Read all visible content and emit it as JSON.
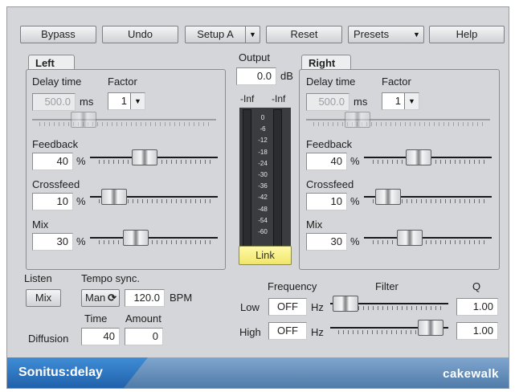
{
  "toolbar": {
    "bypass": "Bypass",
    "undo": "Undo",
    "setup": "Setup A",
    "reset": "Reset",
    "presets": "Presets",
    "help": "Help"
  },
  "output": {
    "label": "Output",
    "value": "0.0",
    "unit": "dB",
    "meter_left_peak": "-Inf",
    "meter_right_peak": "-Inf",
    "scale": [
      "0",
      "-6",
      "-12",
      "-18",
      "-24",
      "-30",
      "-36",
      "-42",
      "-48",
      "-54",
      "-60"
    ],
    "link": "Link"
  },
  "left": {
    "tab": "Left",
    "delay_label": "Delay time",
    "delay_value": "500.0",
    "delay_unit": "ms",
    "factor_label": "Factor",
    "factor_value": "1",
    "feedback_label": "Feedback",
    "feedback_value": "40",
    "crossfeed_label": "Crossfeed",
    "crossfeed_value": "10",
    "mix_label": "Mix",
    "mix_value": "30",
    "percent": "%"
  },
  "right": {
    "tab": "Right",
    "delay_label": "Delay time",
    "delay_value": "500.0",
    "delay_unit": "ms",
    "factor_label": "Factor",
    "factor_value": "1",
    "feedback_label": "Feedback",
    "feedback_value": "40",
    "crossfeed_label": "Crossfeed",
    "crossfeed_value": "10",
    "mix_label": "Mix",
    "mix_value": "30",
    "percent": "%"
  },
  "bottom": {
    "listen_label": "Listen",
    "listen_value": "Mix",
    "tempo_label": "Tempo sync.",
    "tempo_mode": "Man",
    "bpm_value": "120.0",
    "bpm_unit": "BPM",
    "diffusion_label": "Diffusion",
    "time_label": "Time",
    "time_value": "40",
    "amount_label": "Amount",
    "amount_value": "0"
  },
  "filter": {
    "frequency_label": "Frequency",
    "filter_label": "Filter",
    "q_label": "Q",
    "low_label": "Low",
    "low_value": "OFF",
    "high_label": "High",
    "high_value": "OFF",
    "hz": "Hz",
    "low_q": "1.00",
    "high_q": "1.00"
  },
  "footer": {
    "title": "Sonitus:delay",
    "brand": "cakewalk"
  },
  "slider_levels": {
    "left_delay": 0.22,
    "left_feedback": 0.35,
    "left_crossfeed": 0.08,
    "left_mix": 0.27,
    "right_delay": 0.22,
    "right_feedback": 0.35,
    "right_crossfeed": 0.08,
    "right_mix": 0.27,
    "low_freq": 0.02,
    "high_freq": 1.0
  }
}
